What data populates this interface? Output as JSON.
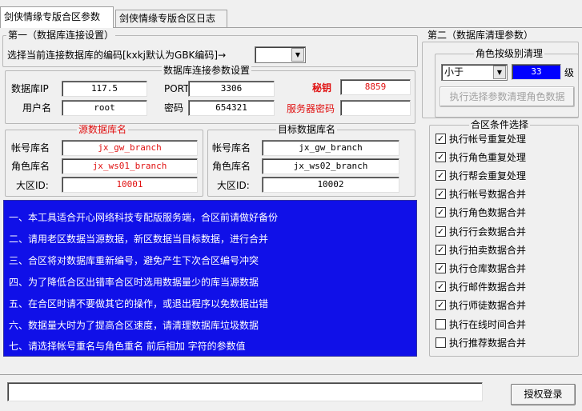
{
  "tabs": [
    {
      "label": "剑侠情缘专版合区参数"
    },
    {
      "label": "剑侠情缘专版合区日志"
    }
  ],
  "section1": {
    "title": "第一（数据库连接设置）",
    "encoding_label": "选择当前连接数据库的编码[kxkj默认为GBK编码]→",
    "encoding_value": ""
  },
  "db_conn": {
    "title": "数据库连接参数设置",
    "ip_label": "数据库IP",
    "ip_value": "117.5",
    "port_label": "PORT",
    "port_value": "3306",
    "secret_label": "秘钥",
    "secret_value": "8859",
    "user_label": "用户名",
    "user_value": "root",
    "pass_label": "密码",
    "pass_value": "654321",
    "server_pass_label": "服务器密码",
    "server_pass_value": ""
  },
  "source_db": {
    "title": "源数据库名",
    "account_label": "帐号库名",
    "account_value": "jx_gw_branch",
    "role_label": "角色库名",
    "role_value": "jx_ws01_branch",
    "region_label": "大区ID:",
    "region_value": "10001"
  },
  "target_db": {
    "title": "目标数据库名",
    "account_label": "帐号库名",
    "account_value": "jx_gw_branch",
    "role_label": "角色库名",
    "role_value": "jx_ws02_branch",
    "region_label": "大区ID:",
    "region_value": "10002"
  },
  "info_lines": [
    "一、本工具适合开心网络科技专配版服务端，合区前请做好备份",
    "二、请用老区数据当源数据，新区数据当目标数据，进行合并",
    "三、合区将对数据库重新编号，避免产生下次合区编号冲突",
    "四、为了降低合区出错率合区时选用数据量少的库当源数据",
    "五、在合区时请不要做其它的操作，或退出程序以免数据出错",
    "六、数据量大时为了提高合区速度，请清理数据库垃圾数据",
    "七、请选择帐号重名与角色重名 前后相加 字符的参数值"
  ],
  "section2": {
    "title": "第二（数据库清理参数）",
    "cleanup_title": "角色按级别清理",
    "comparator_value": "小于",
    "level_value": "33",
    "level_unit": "级",
    "execute_button": "执行选择参数清理角色数据"
  },
  "merge_options": {
    "title": "合区条件选择",
    "items": [
      {
        "label": "执行帐号重复处理",
        "checked": true,
        "mark": "✓"
      },
      {
        "label": "执行角色重复处理",
        "checked": true,
        "mark": "✓"
      },
      {
        "label": "执行帮会重复处理",
        "checked": true,
        "mark": "✓"
      },
      {
        "label": "执行帐号数据合并",
        "checked": true,
        "mark": "✓"
      },
      {
        "label": "执行角色数据合并",
        "checked": true,
        "mark": "✓"
      },
      {
        "label": "执行行会数据合并",
        "checked": true,
        "mark": "✓"
      },
      {
        "label": "执行拍卖数据合并",
        "checked": true,
        "mark": "✓"
      },
      {
        "label": "执行仓库数据合并",
        "checked": true,
        "mark": "✓"
      },
      {
        "label": "执行邮件数据合并",
        "checked": true,
        "mark": "✓"
      },
      {
        "label": "执行师徒数据合并",
        "checked": true,
        "mark": "✓"
      },
      {
        "label": "执行在线时间合并",
        "checked": false,
        "mark": ""
      },
      {
        "label": "执行推荐数据合并",
        "checked": false,
        "mark": ""
      }
    ]
  },
  "status": {
    "text": "",
    "auth_button": "授权登录"
  }
}
